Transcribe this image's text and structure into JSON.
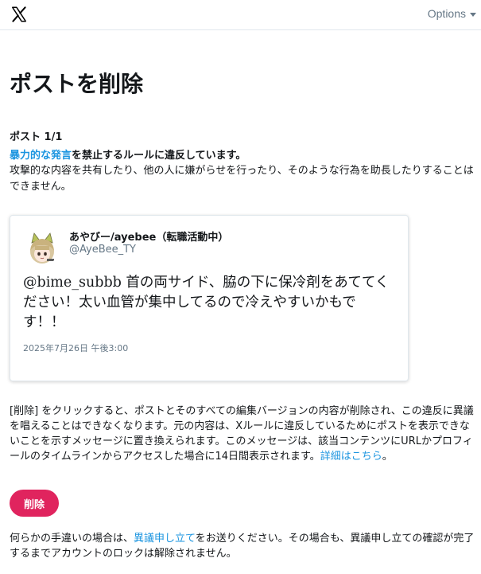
{
  "header": {
    "logo_icon": "x-logo-icon",
    "options_label": "Options"
  },
  "page": {
    "title": "ポストを削除",
    "post_count": "ポスト 1/1"
  },
  "violation": {
    "link_text": "暴力的な発言",
    "rule_text": "を禁止するルールに違反しています。",
    "description": "攻撃的な内容を共有したり、他の人に嫌がらせを行ったり、そのような行為を助長したりすることはできません。"
  },
  "tweet": {
    "display_name": "あやびー/ayebee（転職活動中）",
    "handle": "@AyeBee_TY",
    "text": "@bime_subbb 首の両サイド、脇の下に保冷剤をあててください！太い血管が集中してるので冷えやすいかもです！！",
    "date": "2025年7月26日 午後3:00"
  },
  "delete_info": {
    "text": "[削除] をクリックすると、ポストとそのすべての編集バージョンの内容が削除され、この違反に異議を唱えることはできなくなります。元の内容は、Xルールに違反しているためにポストを表示できないことを示すメッセージに置き換えられます。このメッセージは、該当コンテンツにURLかプロフィールのタイムラインからアクセスした場合に14日間表示されます。",
    "learn_more": "詳細はこちら",
    "period": "。"
  },
  "delete_button": "削除",
  "footer": {
    "before": "何らかの手違いの場合は、",
    "link": "異議申し立て",
    "after": "をお送りください。その場合も、異議申し立ての確認が完了するまでアカウントのロックは解除されません。"
  },
  "colors": {
    "accent_link": "#1b95e0",
    "delete_button": "#e0245e",
    "secondary_text": "#657786"
  }
}
